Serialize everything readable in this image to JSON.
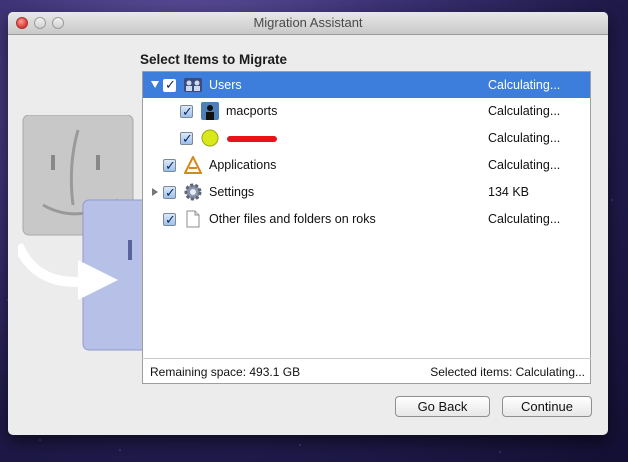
{
  "window": {
    "title": "Migration Assistant"
  },
  "heading": "Select Items to Migrate",
  "items": [
    {
      "label": "Users",
      "value": "Calculating...",
      "icon": "users-icon",
      "selected": true,
      "expanded": true,
      "checked": true
    },
    {
      "label": "macports",
      "value": "Calculating...",
      "icon": "user-icon",
      "checked": true
    },
    {
      "label": "",
      "value": "Calculating...",
      "icon": "tennis-ball-icon",
      "checked": true,
      "redacted": true
    },
    {
      "label": "Applications",
      "value": "Calculating...",
      "icon": "applications-icon",
      "checked": true
    },
    {
      "label": "Settings",
      "value": "134 KB",
      "icon": "gear-icon",
      "checked": true,
      "collapsed": true
    },
    {
      "label": "Other files and folders on roks",
      "value": "Calculating...",
      "icon": "document-icon",
      "checked": true
    }
  ],
  "status": {
    "remaining": "Remaining space: 493.1 GB",
    "selected": "Selected items: Calculating..."
  },
  "buttons": {
    "go_back": "Go Back",
    "continue": "Continue"
  },
  "colors": {
    "selection": "#3d7edc",
    "redaction": "#e8121c"
  }
}
